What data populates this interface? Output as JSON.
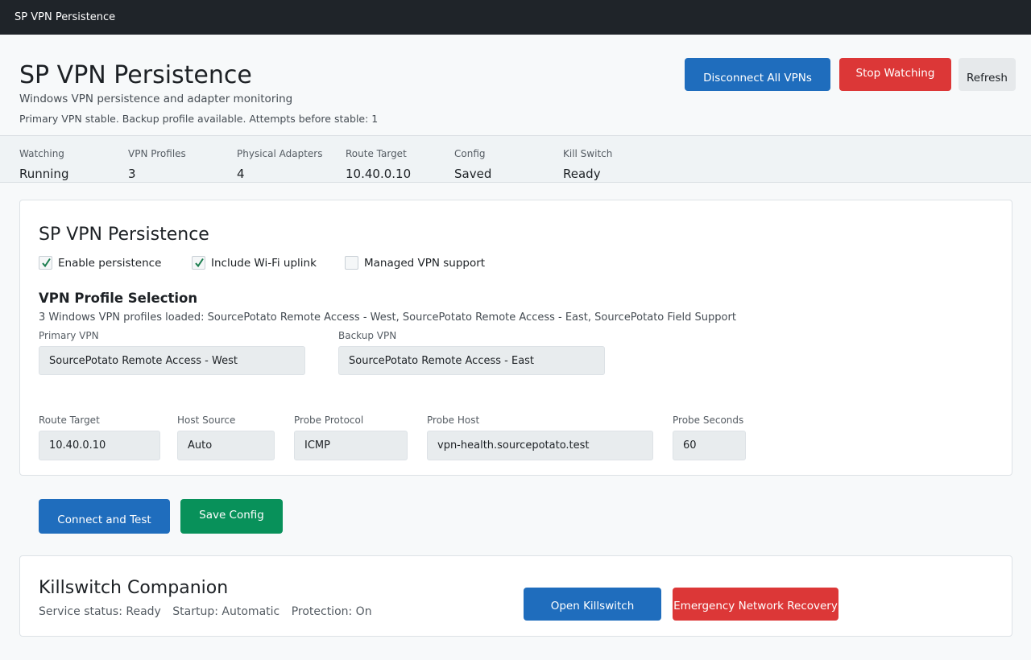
{
  "window": {
    "title": "SP VPN Persistence"
  },
  "header": {
    "title": "SP VPN Persistence",
    "subtitle": "Windows VPN persistence and adapter monitoring",
    "status": "Primary VPN stable. Backup profile available. Attempts before stable: 1",
    "buttons": {
      "disconnect": "Disconnect All VPNs",
      "stop": "Stop Watching",
      "refresh": "Refresh"
    }
  },
  "stats": [
    {
      "label": "Watching",
      "value": "Running"
    },
    {
      "label": "VPN Profiles",
      "value": "3"
    },
    {
      "label": "Physical Adapters",
      "value": "4"
    },
    {
      "label": "Route Target",
      "value": "10.40.0.10"
    },
    {
      "label": "Config",
      "value": "Saved"
    },
    {
      "label": "Kill Switch",
      "value": "Ready"
    }
  ],
  "settings": {
    "title": "SP VPN Persistence",
    "checkboxes": [
      {
        "label": "Enable persistence",
        "checked": true
      },
      {
        "label": "Include Wi-Fi uplink",
        "checked": true
      },
      {
        "label": "Managed VPN support",
        "checked": false
      }
    ],
    "profile_heading": "VPN Profile Selection",
    "profiles_loaded": "3 Windows VPN profiles loaded: SourcePotato Remote Access - West, SourcePotato Remote Access - East, SourcePotato Field Support",
    "primary_label": "Primary VPN",
    "primary_value": "SourcePotato Remote Access - West",
    "backup_label": "Backup VPN",
    "backup_value": "SourcePotato Remote Access - East",
    "route_target_label": "Route Target",
    "route_target_value": "10.40.0.10",
    "host_source_label": "Host Source",
    "host_source_value": "Auto",
    "probe_protocol_label": "Probe Protocol",
    "probe_protocol_value": "ICMP",
    "probe_host_label": "Probe Host",
    "probe_host_value": "vpn-health.sourcepotato.test",
    "probe_seconds_label": "Probe Seconds",
    "probe_seconds_value": "60"
  },
  "actions": {
    "connect_test": "Connect and Test",
    "save_config": "Save Config"
  },
  "companion": {
    "title": "Killswitch Companion",
    "service_status": "Service status: Ready",
    "startup": "Startup: Automatic",
    "protection": "Protection: On",
    "open_button": "Open Killswitch",
    "recovery_button": "Emergency Network Recovery"
  },
  "colors": {
    "primary": "#1f6dbd",
    "danger": "#dc3737",
    "success": "#08915a",
    "titlebar": "#1f2429",
    "check": "#1a7d4e"
  }
}
